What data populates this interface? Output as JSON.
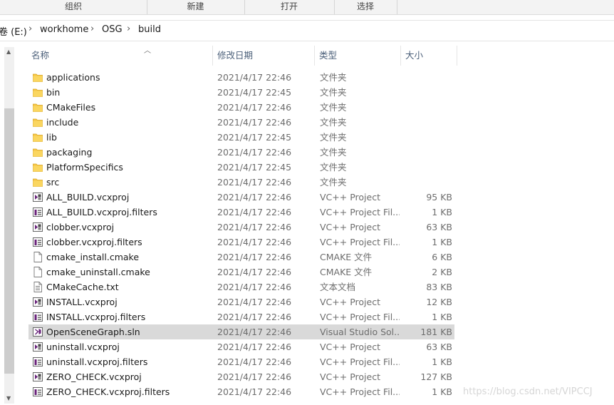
{
  "ribbon": {
    "groups": [
      "组织",
      "新建",
      "打开",
      "选择"
    ]
  },
  "address": {
    "drive": "卷 (E:)",
    "crumbs": [
      "workhome",
      "OSG",
      "build"
    ]
  },
  "columns": {
    "name": "名称",
    "date": "修改日期",
    "type": "类型",
    "size": "大小"
  },
  "files": [
    {
      "name": "applications",
      "date": "2021/4/17 22:46",
      "type": "文件夹",
      "size": "",
      "icon": "folder-icon"
    },
    {
      "name": "bin",
      "date": "2021/4/17 22:45",
      "type": "文件夹",
      "size": "",
      "icon": "folder-icon"
    },
    {
      "name": "CMakeFiles",
      "date": "2021/4/17 22:46",
      "type": "文件夹",
      "size": "",
      "icon": "folder-icon"
    },
    {
      "name": "include",
      "date": "2021/4/17 22:46",
      "type": "文件夹",
      "size": "",
      "icon": "folder-icon"
    },
    {
      "name": "lib",
      "date": "2021/4/17 22:45",
      "type": "文件夹",
      "size": "",
      "icon": "folder-icon"
    },
    {
      "name": "packaging",
      "date": "2021/4/17 22:46",
      "type": "文件夹",
      "size": "",
      "icon": "folder-icon"
    },
    {
      "name": "PlatformSpecifics",
      "date": "2021/4/17 22:45",
      "type": "文件夹",
      "size": "",
      "icon": "folder-icon"
    },
    {
      "name": "src",
      "date": "2021/4/17 22:46",
      "type": "文件夹",
      "size": "",
      "icon": "folder-icon"
    },
    {
      "name": "ALL_BUILD.vcxproj",
      "date": "2021/4/17 22:46",
      "type": "VC++ Project",
      "size": "95 KB",
      "icon": "vcxproj-icon"
    },
    {
      "name": "ALL_BUILD.vcxproj.filters",
      "date": "2021/4/17 22:46",
      "type": "VC++ Project Fil...",
      "size": "1 KB",
      "icon": "filters-icon"
    },
    {
      "name": "clobber.vcxproj",
      "date": "2021/4/17 22:46",
      "type": "VC++ Project",
      "size": "63 KB",
      "icon": "vcxproj-icon"
    },
    {
      "name": "clobber.vcxproj.filters",
      "date": "2021/4/17 22:46",
      "type": "VC++ Project Fil...",
      "size": "1 KB",
      "icon": "filters-icon"
    },
    {
      "name": "cmake_install.cmake",
      "date": "2021/4/17 22:46",
      "type": "CMAKE 文件",
      "size": "6 KB",
      "icon": "blank-file-icon"
    },
    {
      "name": "cmake_uninstall.cmake",
      "date": "2021/4/17 22:46",
      "type": "CMAKE 文件",
      "size": "2 KB",
      "icon": "blank-file-icon"
    },
    {
      "name": "CMakeCache.txt",
      "date": "2021/4/17 22:46",
      "type": "文本文档",
      "size": "83 KB",
      "icon": "text-file-icon"
    },
    {
      "name": "INSTALL.vcxproj",
      "date": "2021/4/17 22:46",
      "type": "VC++ Project",
      "size": "12 KB",
      "icon": "vcxproj-icon"
    },
    {
      "name": "INSTALL.vcxproj.filters",
      "date": "2021/4/17 22:46",
      "type": "VC++ Project Fil...",
      "size": "1 KB",
      "icon": "filters-icon"
    },
    {
      "name": "OpenSceneGraph.sln",
      "date": "2021/4/17 22:46",
      "type": "Visual Studio Sol...",
      "size": "181 KB",
      "icon": "sln-icon",
      "selected": true
    },
    {
      "name": "uninstall.vcxproj",
      "date": "2021/4/17 22:46",
      "type": "VC++ Project",
      "size": "63 KB",
      "icon": "vcxproj-icon"
    },
    {
      "name": "uninstall.vcxproj.filters",
      "date": "2021/4/17 22:46",
      "type": "VC++ Project Fil...",
      "size": "1 KB",
      "icon": "filters-icon"
    },
    {
      "name": "ZERO_CHECK.vcxproj",
      "date": "2021/4/17 22:46",
      "type": "VC++ Project",
      "size": "127 KB",
      "icon": "vcxproj-icon"
    },
    {
      "name": "ZERO_CHECK.vcxproj.filters",
      "date": "2021/4/17 22:46",
      "type": "VC++ Project Fil...",
      "size": "1 KB",
      "icon": "filters-icon"
    }
  ],
  "watermark": "https://blog.csdn.net/VIPCCJ",
  "colors": {
    "folder": "#f7c747",
    "selection": "#d9d9d9",
    "vs_purple": "#68217a",
    "header_text": "#4c607a"
  }
}
